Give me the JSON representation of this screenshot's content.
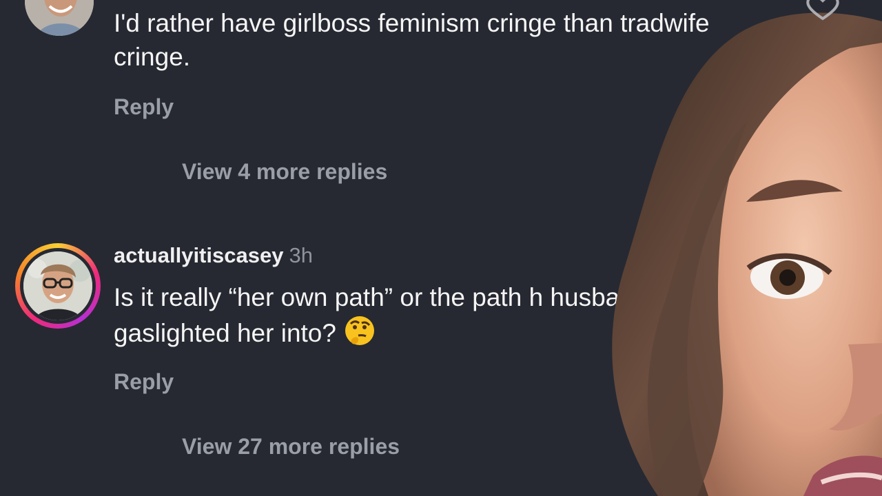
{
  "comments": [
    {
      "text": "I'd rather have girlboss feminism cringe than tradwife cringe.",
      "reply_label": "Reply",
      "view_replies_label": "View 4 more replies"
    },
    {
      "username": "actuallyitiscasey",
      "time": "3h",
      "text": "Is it really “her own path” or the path h husband gaslighted her into?",
      "reply_label": "Reply",
      "view_replies_label": "View 27 more replies"
    }
  ],
  "icons": {
    "like": "heart-icon",
    "thinking": "thinking-face-emoji"
  },
  "colors": {
    "background": "#262932",
    "text": "#f5f5f5",
    "muted": "#9a9ea7",
    "story_ring": "#ee2a7b"
  }
}
